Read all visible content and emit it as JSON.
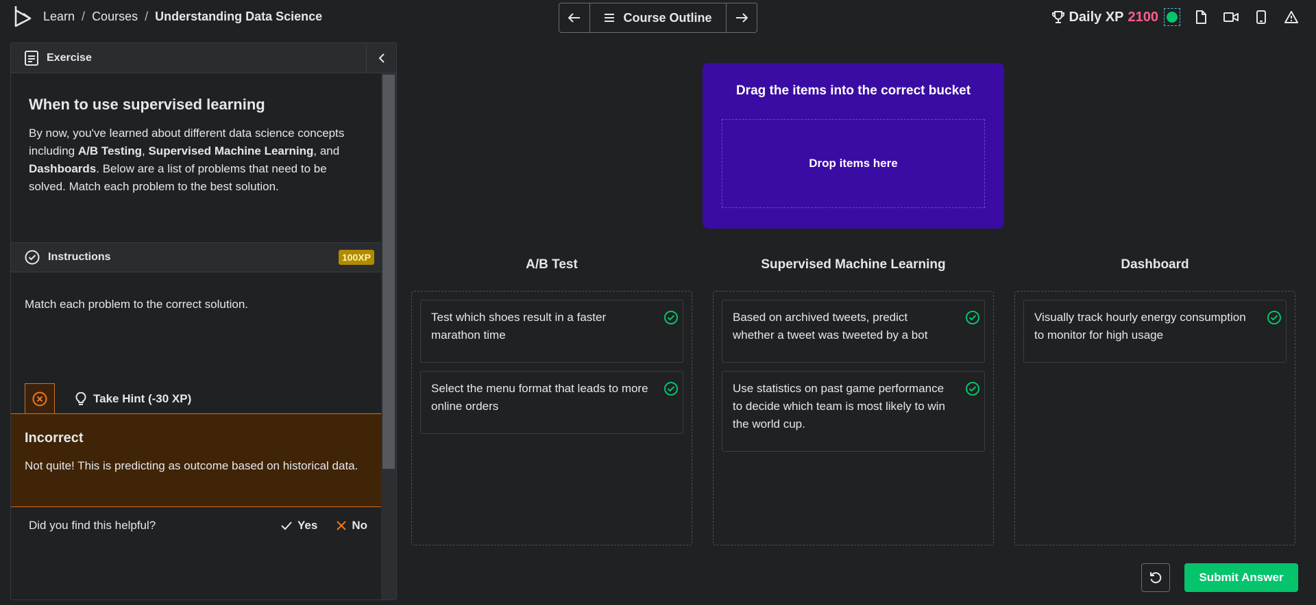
{
  "breadcrumb": {
    "items": [
      "Learn",
      "Courses",
      "Understanding Data Science"
    ],
    "separator": "/"
  },
  "course_nav": {
    "outline_label": "Course Outline",
    "prev_icon": "arrow-left-icon",
    "next_icon": "arrow-right-icon"
  },
  "header": {
    "xp_label": "Daily XP",
    "xp_value": "2100",
    "xp_color": "#ff5e8e",
    "status_color": "#05c46b",
    "icons": [
      "trophy-icon",
      "document-icon",
      "video-icon",
      "mobile-icon",
      "alert-icon"
    ]
  },
  "panel": {
    "header_title": "Exercise",
    "exercise_title": "When to use supervised learning",
    "body": {
      "p1": "By now, you've learned about different data science concepts including ",
      "b1": "A/B Testing",
      "p2": ", ",
      "b2": "Supervised Machine Learning",
      "p3": ", and ",
      "b3": "Dashboards",
      "p4": ". Below are a list of problems that need to be solved. Match each problem to the best solution."
    },
    "instructions_label": "Instructions",
    "xp_badge": "100XP",
    "instructions_text": "Match each problem to the correct solution.",
    "hint_label": "Take Hint (-30 XP)",
    "incorrect": {
      "title": "Incorrect",
      "message": "Not quite! This is predicting as outcome based on historical data."
    },
    "feedback": {
      "question": "Did you find this helpful?",
      "yes": "Yes",
      "no": "No"
    }
  },
  "dropzone": {
    "title": "Drag the items into the correct bucket",
    "placeholder": "Drop items here",
    "color": "#3a0ca3"
  },
  "buckets": [
    {
      "title": "A/B Test",
      "items": [
        "Test which shoes result in a faster marathon time",
        "Select the menu format that leads to more online orders"
      ]
    },
    {
      "title": "Supervised Machine Learning",
      "items": [
        "Based on archived tweets, predict whether a tweet was tweeted by a bot",
        "Use statistics on past game performance to decide which team is most likely to win the world cup."
      ]
    },
    {
      "title": "Dashboard",
      "items": [
        "Visually track hourly energy consumption to monitor for high usage"
      ]
    }
  ],
  "actions": {
    "submit_label": "Submit Answer",
    "submit_color": "#05c46b",
    "reset_icon": "reset-icon"
  }
}
